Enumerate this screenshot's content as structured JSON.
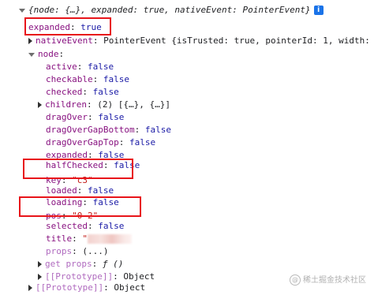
{
  "header": {
    "text": "{node: {…}, expanded: true, nativeEvent: PointerEvent}",
    "info_icon": "i"
  },
  "lines": {
    "expanded_top": {
      "key": "expanded",
      "value": "true"
    },
    "nativeEvent": {
      "key": "nativeEvent",
      "value": "PointerEvent {isTrusted: true, pointerId: 1, width: 1,"
    },
    "node": {
      "key": "node"
    },
    "active": {
      "key": "active",
      "value": "false"
    },
    "checkable": {
      "key": "checkable",
      "value": "false"
    },
    "checked": {
      "key": "checked",
      "value": "false"
    },
    "children": {
      "key": "children",
      "value": "(2) [{…}, {…}]"
    },
    "dragOver": {
      "key": "dragOver",
      "value": "false"
    },
    "dragOverGapBottom": {
      "key": "dragOverGapBottom",
      "value": "false"
    },
    "dragOverGapTop": {
      "key": "dragOverGapTop",
      "value": "false"
    },
    "expanded": {
      "key": "expanded",
      "value": "false"
    },
    "halfChecked": {
      "key": "halfChecked",
      "value": "false"
    },
    "key": {
      "key": "key",
      "value": "\"c3\""
    },
    "loaded": {
      "key": "loaded",
      "value": "false"
    },
    "loading": {
      "key": "loading",
      "value": "false"
    },
    "pos": {
      "key": "pos",
      "value": "\"0-2\""
    },
    "selected": {
      "key": "selected",
      "value": "false"
    },
    "title": {
      "key": "title",
      "value": "\""
    },
    "props": {
      "key": "props",
      "value": "(...)"
    },
    "get_props": {
      "key": "get props",
      "value": "ƒ ()"
    },
    "proto_inner": {
      "key": "[[Prototype]]",
      "value": "Object"
    },
    "proto_outer": {
      "key": "[[Prototype]]",
      "value": "Object"
    }
  },
  "watermark": "稀土掘金技术社区",
  "colors": {
    "property_key": "#881280",
    "boolean": "#1a1aa6",
    "string": "#c41a16",
    "highlight_box": "#e8141a"
  }
}
